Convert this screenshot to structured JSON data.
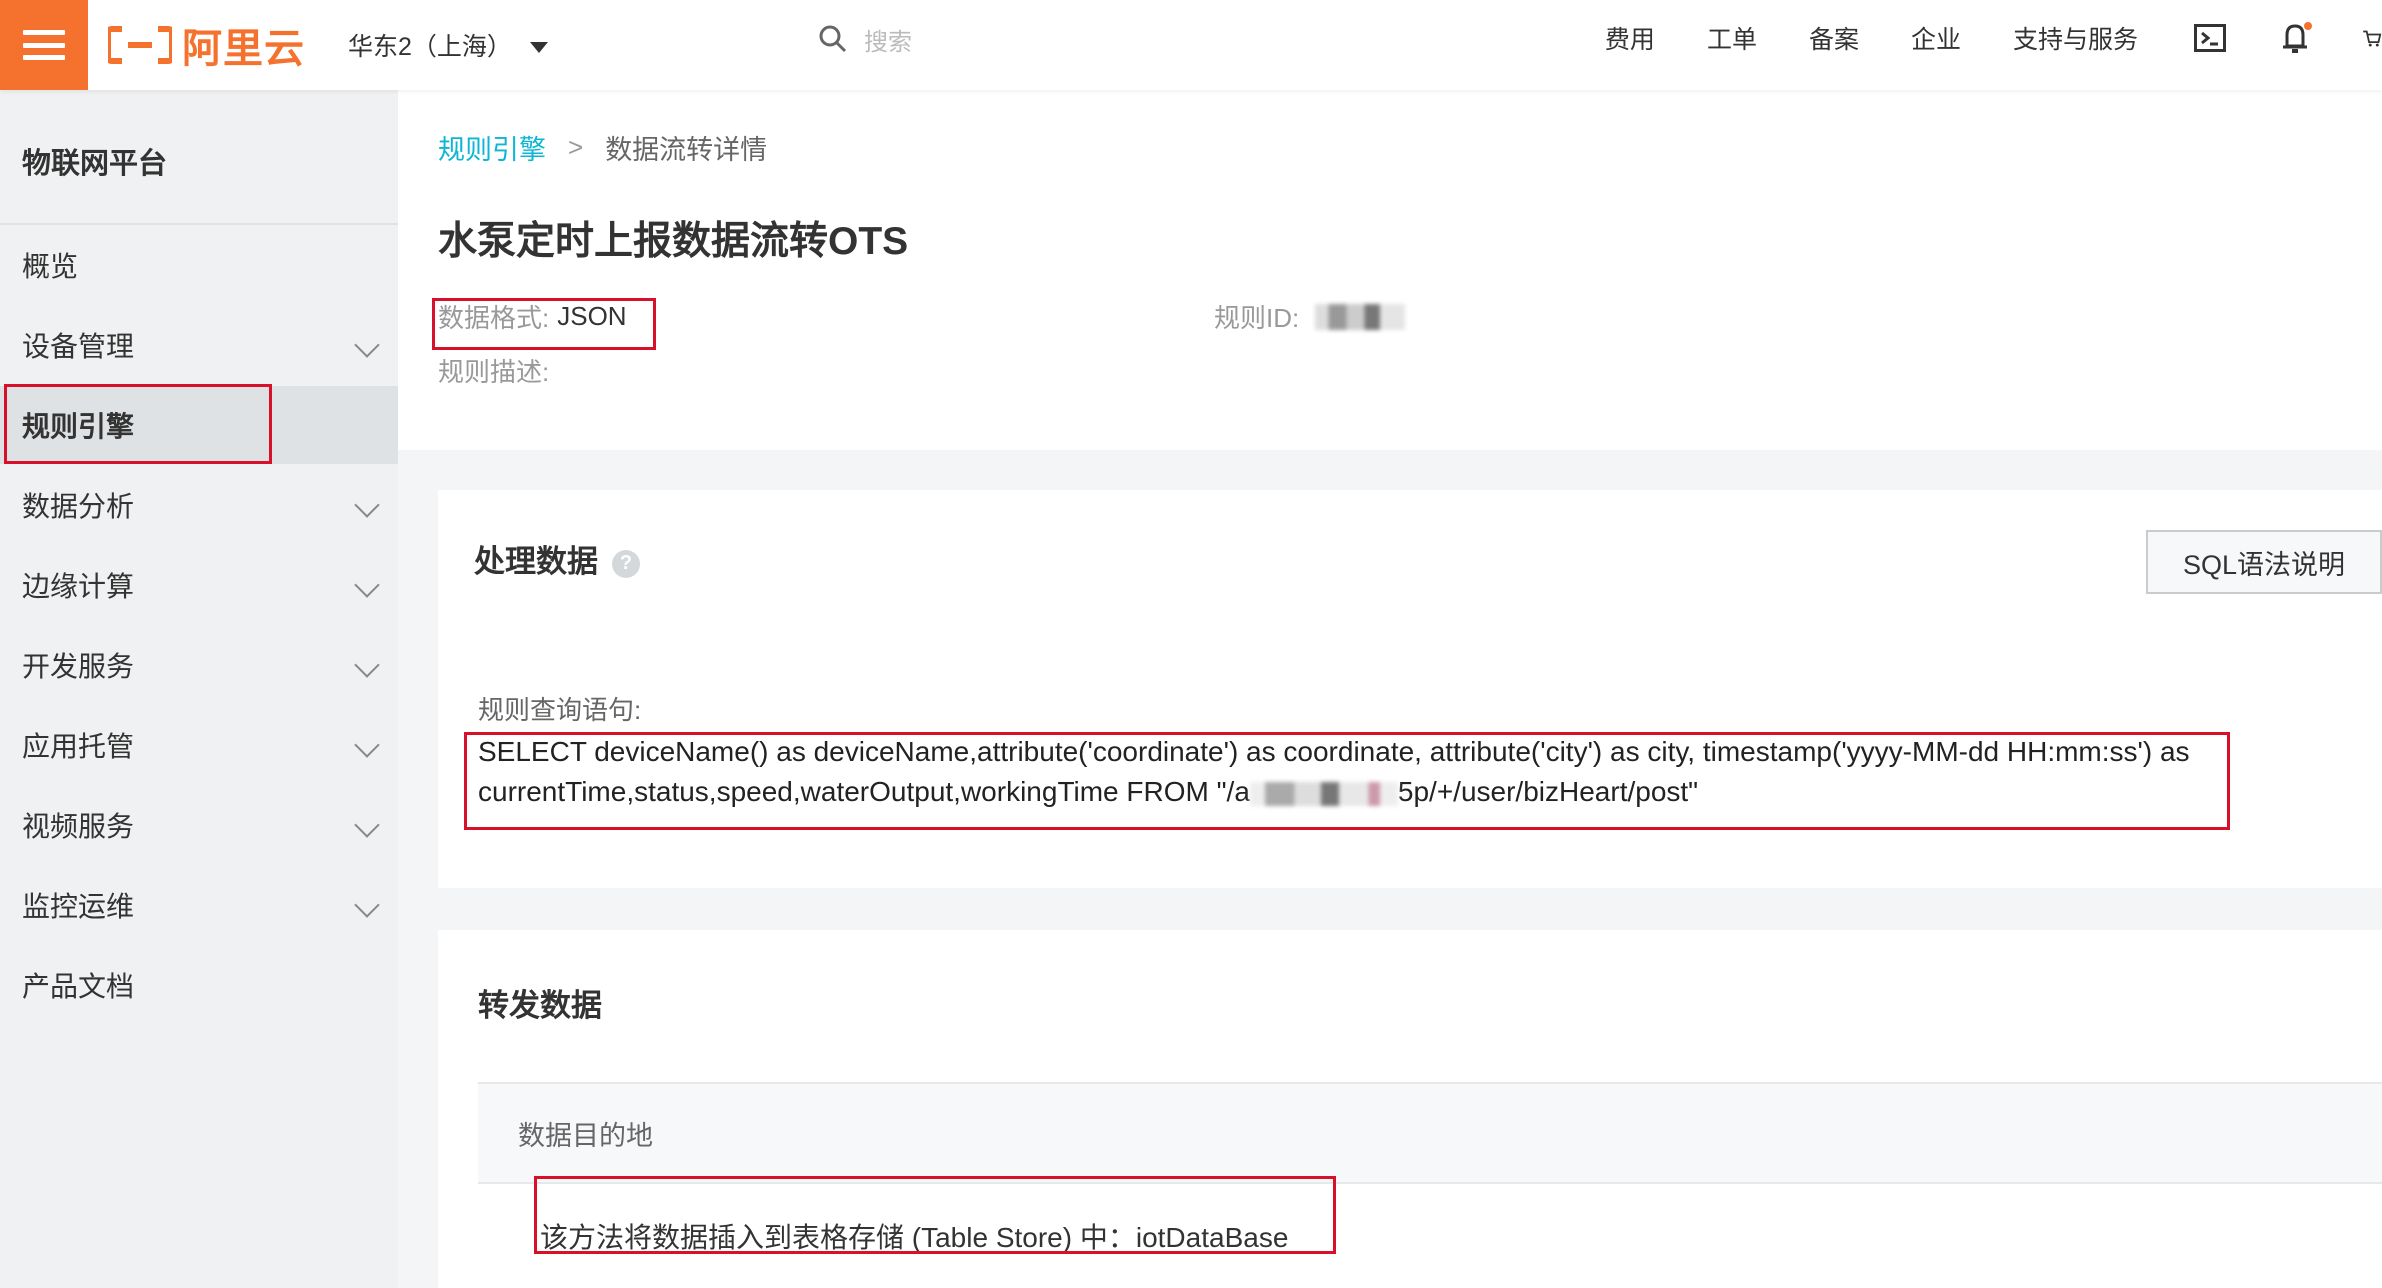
{
  "topbar": {
    "brand": "阿里云",
    "region": "华东2（上海）",
    "search_placeholder": "搜索",
    "nav": [
      "费用",
      "工单",
      "备案",
      "企业",
      "支持与服务"
    ]
  },
  "sidebar": {
    "title": "物联网平台",
    "items": [
      {
        "label": "概览",
        "has_children": false
      },
      {
        "label": "设备管理",
        "has_children": true
      },
      {
        "label": "规则引擎",
        "has_children": false,
        "active": true
      },
      {
        "label": "数据分析",
        "has_children": true
      },
      {
        "label": "边缘计算",
        "has_children": true
      },
      {
        "label": "开发服务",
        "has_children": true
      },
      {
        "label": "应用托管",
        "has_children": true
      },
      {
        "label": "视频服务",
        "has_children": true
      },
      {
        "label": "监控运维",
        "has_children": true
      },
      {
        "label": "产品文档",
        "has_children": false
      }
    ]
  },
  "breadcrumb": {
    "parent": "规则引擎",
    "separator": ">",
    "current": "数据流转详情"
  },
  "page": {
    "title": "水泵定时上报数据流转OTS",
    "format_label": "数据格式:",
    "format_value": "JSON",
    "rule_id_label": "规则ID:",
    "description_label": "规则描述:"
  },
  "process": {
    "title": "处理数据",
    "help": "?",
    "sql_button": "SQL语法说明",
    "query_label": "规则查询语句:",
    "query_part1": "SELECT deviceName() as deviceName,attribute('coordinate') as coordinate, attribute('city') as city, timestamp('yyyy-MM-dd HH:mm:ss') as currentTime,status,speed,waterOutput,workingTime FROM \"/a",
    "query_part2": "5p/+/user/bizHeart/post\""
  },
  "forward": {
    "title": "转发数据",
    "column": "数据目的地",
    "row": "该方法将数据插入到表格存储 (Table Store) 中：iotDataBase"
  },
  "colors": {
    "brand_orange": "#f5712e",
    "link_cyan": "#0db6d4",
    "highlight_red": "#d9102a"
  }
}
